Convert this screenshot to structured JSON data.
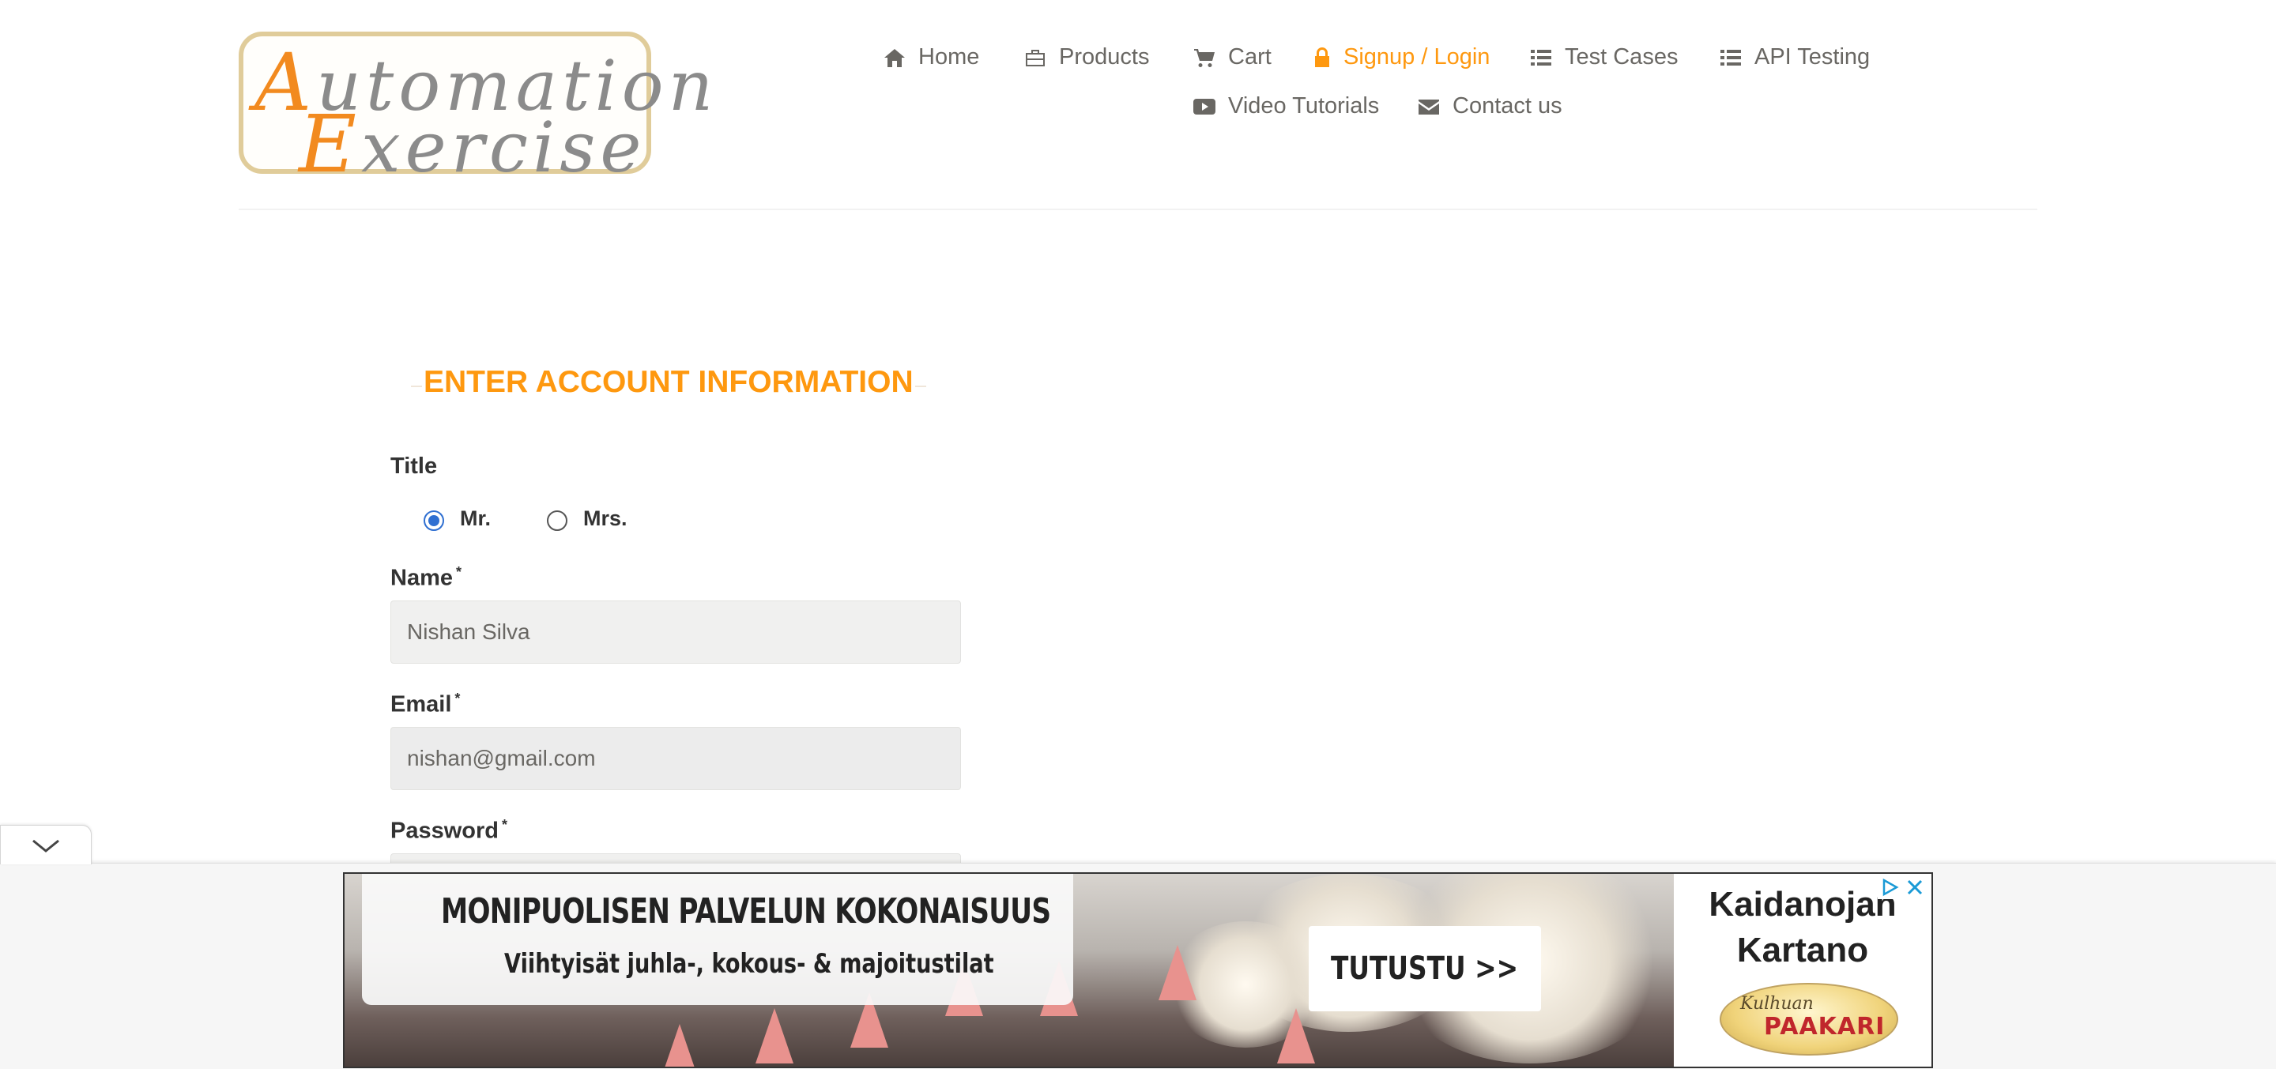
{
  "logo": {
    "line1_cap": "A",
    "line1_rest": "utomation",
    "line2_cap": "E",
    "line2_rest": "xercise"
  },
  "nav": {
    "home": "Home",
    "products": "Products",
    "cart": "Cart",
    "signup_login": "Signup / Login",
    "test_cases": "Test Cases",
    "api_testing": "API Testing",
    "video_tutorials": "Video Tutorials",
    "contact_us": "Contact us"
  },
  "form": {
    "title": "ENTER ACCOUNT INFORMATION",
    "title_label": "Title",
    "options": [
      {
        "label": "Mr.",
        "selected": true
      },
      {
        "label": "Mrs.",
        "selected": false
      }
    ],
    "name_label": "Name",
    "name_value": "Nishan Silva",
    "email_label": "Email",
    "email_value": "nishan@gmail.com",
    "password_label": "Password",
    "required_mark": "*"
  },
  "ad": {
    "headline": "MONIPUOLISEN PALVELUN KOKONAISUUS",
    "subline": "Viihtyisät juhla-, kokous- & majoitustilat",
    "cta": "TUTUSTU >>",
    "brand_line1": "Kaidanojan",
    "brand_line2": "Kartano",
    "badge_script": "Kulhuan",
    "badge_name": "PAAKARI"
  },
  "colors": {
    "accent": "#fe980f",
    "text": "#696763",
    "radio": "#2f6fd1"
  }
}
